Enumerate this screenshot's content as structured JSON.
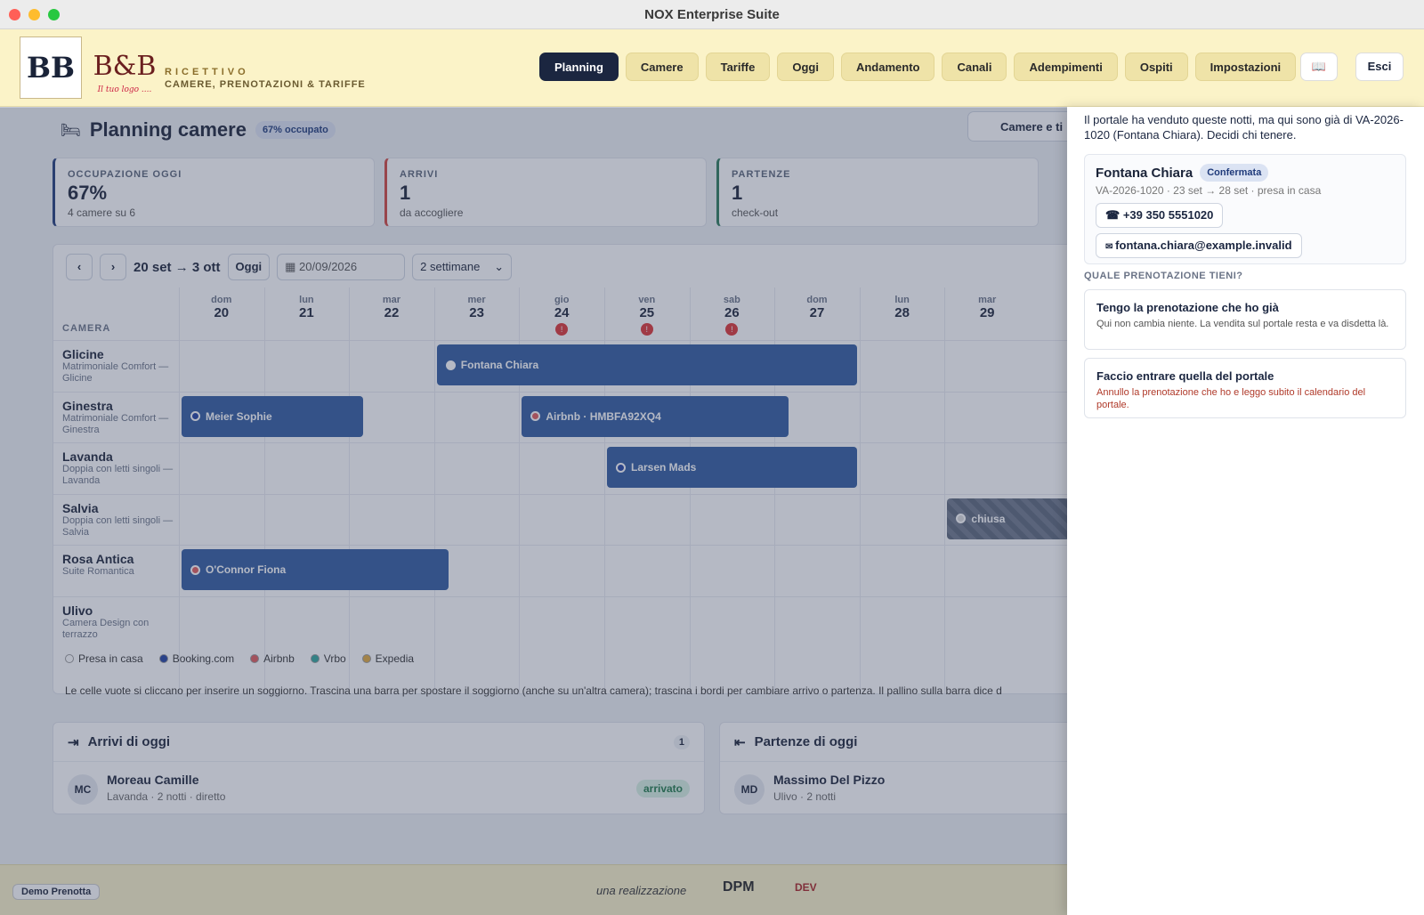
{
  "window": {
    "title": "NOX Enterprise Suite",
    "dot_colors": [
      "#ff5f57",
      "#febc2e",
      "#28c840"
    ]
  },
  "header": {
    "logo1_text": "BB",
    "logo2_text": "B&B",
    "logo2_sub": "Il tuo logo ....",
    "brand_line1": "RICETTIVO",
    "brand_line2": "CAMERE, PRENOTAZIONI & TARIFFE",
    "nav": [
      "Planning",
      "Camere",
      "Tariffe",
      "Oggi",
      "Andamento",
      "Canali",
      "Adempimenti",
      "Ospiti",
      "Impostazioni"
    ],
    "active_nav": "Planning",
    "book_icon": "📖",
    "exit_label": "Esci"
  },
  "page": {
    "title": "Planning camere",
    "occupancy_badge": "67% occupato",
    "top_button": "Camere e ti"
  },
  "kpis": [
    {
      "label": "OCCUPAZIONE OGGI",
      "value": "67%",
      "sub": "4 camere su 6",
      "color": "#1f3a7a"
    },
    {
      "label": "ARRIVI",
      "value": "1",
      "sub": "da accogliere",
      "color": "#d0453e"
    },
    {
      "label": "PARTENZE",
      "value": "1",
      "sub": "check-out",
      "color": "#2a7a5a"
    }
  ],
  "calendar": {
    "prev": "‹",
    "next": "›",
    "range": "20 set → 3 ott",
    "today_btn": "Oggi",
    "date_value": "20/09/2026",
    "span_select": "2 settimane",
    "room_header": "CAMERA",
    "days": [
      {
        "dw": "dom",
        "dn": "20"
      },
      {
        "dw": "lun",
        "dn": "21"
      },
      {
        "dw": "mar",
        "dn": "22"
      },
      {
        "dw": "mer",
        "dn": "23"
      },
      {
        "dw": "gio",
        "dn": "24",
        "warn": true
      },
      {
        "dw": "ven",
        "dn": "25",
        "warn": true
      },
      {
        "dw": "sab",
        "dn": "26",
        "warn": true
      },
      {
        "dw": "dom",
        "dn": "27"
      },
      {
        "dw": "lun",
        "dn": "28"
      },
      {
        "dw": "mar",
        "dn": "29"
      }
    ],
    "rooms": [
      {
        "name": "Glicine",
        "desc": "Matrimoniale Comfort — Glicine"
      },
      {
        "name": "Ginestra",
        "desc": "Matrimoniale Comfort — Ginestra"
      },
      {
        "name": "Lavanda",
        "desc": "Doppia con letti singoli — Lavanda"
      },
      {
        "name": "Salvia",
        "desc": "Doppia con letti singoli — Salvia"
      },
      {
        "name": "Rosa Antica",
        "desc": "Suite Romantica"
      },
      {
        "name": "Ulivo",
        "desc": "Camera Design con terrazzo"
      }
    ],
    "bookings": [
      {
        "room": 0,
        "start": 3,
        "end": 8,
        "label": "Fontana Chiara",
        "channel": "casa"
      },
      {
        "room": 1,
        "start": 0,
        "end": 2.2,
        "label": "Meier Sophie",
        "channel": "booking"
      },
      {
        "room": 1,
        "start": 4,
        "end": 7.2,
        "label": "Airbnb · HMBFA92XQ4",
        "channel": "airbnb"
      },
      {
        "room": 2,
        "start": 5,
        "end": 8,
        "label": "Larsen Mads",
        "channel": "booking"
      },
      {
        "room": 3,
        "start": 9,
        "end": 10.5,
        "label": "chiusa",
        "channel": "closed"
      },
      {
        "room": 4,
        "start": 0,
        "end": 3.2,
        "label": "O'Connor Fiona",
        "channel": "airbnb"
      }
    ],
    "legend": [
      {
        "label": "Presa in casa",
        "color": "#ffffff"
      },
      {
        "label": "Booking.com",
        "color": "#1f3fa0"
      },
      {
        "label": "Airbnb",
        "color": "#e05a5a"
      },
      {
        "label": "Vrbo",
        "color": "#2fa59a"
      },
      {
        "label": "Expedia",
        "color": "#e0a93a"
      }
    ],
    "hint": "Le celle vuote si cliccano per inserire un soggiorno. Trascina una barra per spostare il soggiorno (anche su un'altra camera); trascina i bordi per cambiare arrivo o partenza. Il pallino sulla barra dice d"
  },
  "arrivals": {
    "title": "Arrivi di oggi",
    "count": "1",
    "initials": "MC",
    "name": "Moreau Camille",
    "sub": "Lavanda · 2 notti · diretto",
    "status": "arrivato"
  },
  "departures": {
    "title": "Partenze di oggi",
    "initials": "MD",
    "name": "Massimo Del Pizzo",
    "sub": "Ulivo · 2 notti"
  },
  "footer": {
    "demo": "Demo Prenotta",
    "credit": "una realizzazione",
    "logo_a": "DPM",
    "logo_b": "DEV"
  },
  "drawer": {
    "intro": "Il portale ha venduto queste notti, ma qui sono già di VA-2026-1020 (Fontana Chiara). Decidi chi tenere.",
    "guest": "Fontana Chiara",
    "status": "Confermata",
    "meta": "VA-2026-1020 · 23 set → 28 set · presa in casa",
    "phone": "+39 350 5551020",
    "email": "fontana.chiara@example.invalid",
    "question": "QUALE PRENOTAZIONE TIENI?",
    "option1_title": "Tengo la prenotazione che ho già",
    "option1_sub": "Qui non cambia niente. La vendita sul portale resta e va disdetta là.",
    "option2_title": "Faccio entrare quella del portale",
    "option2_sub": "Annullo la prenotazione che ho e leggo subito il calendario del portale."
  }
}
